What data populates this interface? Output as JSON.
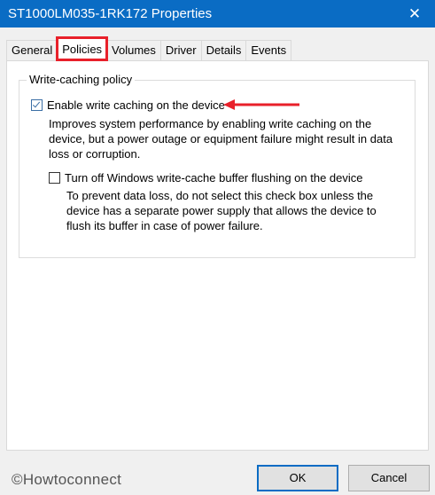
{
  "window": {
    "title": "ST1000LM035-1RK172 Properties",
    "close_glyph": "✕"
  },
  "tabs": [
    {
      "label": "General"
    },
    {
      "label": "Policies",
      "selected": true
    },
    {
      "label": "Volumes"
    },
    {
      "label": "Driver"
    },
    {
      "label": "Details"
    },
    {
      "label": "Events"
    }
  ],
  "policy": {
    "group_title": "Write-caching policy",
    "enable_write_caching": {
      "label": "Enable write caching on the device",
      "checked": true,
      "description_lines": [
        "Improves system performance by enabling write caching on the",
        "device, but a power outage or equipment failure might result in data",
        "loss or corruption."
      ]
    },
    "turn_off_flushing": {
      "label": "Turn off Windows write-cache buffer flushing on the device",
      "checked": false,
      "description_lines": [
        "To prevent data loss, do not select this check box unless the",
        "device has a separate power supply that allows the device to",
        "flush its buffer in case of power failure."
      ]
    }
  },
  "watermark": "©Howtoconnect",
  "buttons": {
    "ok": "OK",
    "cancel": "Cancel"
  },
  "colors": {
    "titlebar": "#0a6cc4",
    "highlight_red": "#e8202a"
  }
}
